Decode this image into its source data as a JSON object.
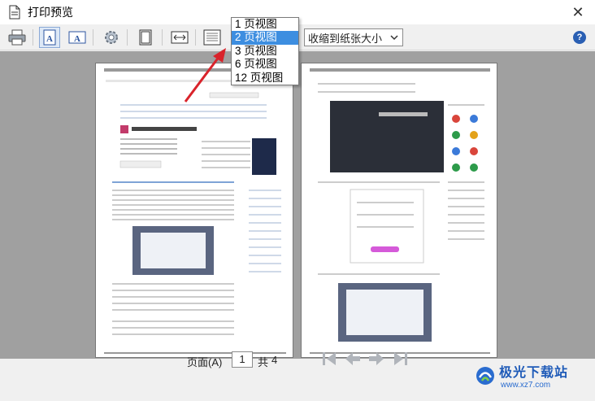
{
  "window": {
    "title": "打印预览"
  },
  "toolbar": {
    "zoom_value": "收缩到纸张大小",
    "help_label": "?"
  },
  "pages_dropdown": {
    "options": [
      "1 页视图",
      "2 页视图",
      "3 页视图",
      "6 页视图",
      "12 页视图"
    ],
    "selected_index": 1
  },
  "pager": {
    "page_label": "页面(A)",
    "current_page": "1",
    "total_label": "共",
    "total_pages": "4"
  },
  "watermark": {
    "brand": "极光下载站",
    "url": "www.xz7.com"
  },
  "colors": {
    "accent": "#3d8ee0",
    "arrow": "#d9232b",
    "preview_bg": "#a0a0a0"
  }
}
